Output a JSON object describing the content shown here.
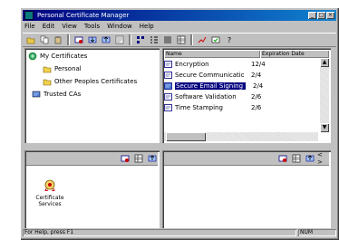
{
  "window": {
    "title": "Personal Certificate Manager",
    "buttons": [
      "_",
      "□",
      "×"
    ]
  },
  "menu": [
    "File",
    "Edit",
    "View",
    "Tools",
    "Window",
    "Help"
  ],
  "tree": [
    {
      "label": "My Certificates",
      "icon": "tree-root-icon"
    },
    {
      "label": "Personal",
      "icon": "folder-icon"
    },
    {
      "label": "Other Peoples Certificates",
      "icon": "folder-icon"
    },
    {
      "label": "Trusted CAs",
      "icon": "ca-icon"
    }
  ],
  "list": {
    "columns": [
      "Name",
      "Expiration Date"
    ],
    "rows": [
      {
        "name": "Encryption",
        "value": "12/4",
        "selected": false,
        "icon": "cert-icon"
      },
      {
        "name": "Secure Communication",
        "value": "2/4",
        "selected": false,
        "icon": "cert-icon"
      },
      {
        "name": "Secure Email Signing",
        "value": "2/4",
        "selected": true,
        "icon": "cert-icon"
      },
      {
        "name": "Software Validation",
        "value": "2/6",
        "selected": false,
        "icon": "cert-icon"
      },
      {
        "name": "Time Stamping",
        "value": "2/6",
        "selected": false,
        "icon": "cert-icon"
      }
    ]
  },
  "lower_left": {
    "title": "",
    "item_label": "Certificate Services"
  },
  "lower_right": {
    "title": "",
    "navigation": "< >"
  },
  "status": {
    "left": "For Help, press F1",
    "right": "NUM"
  }
}
